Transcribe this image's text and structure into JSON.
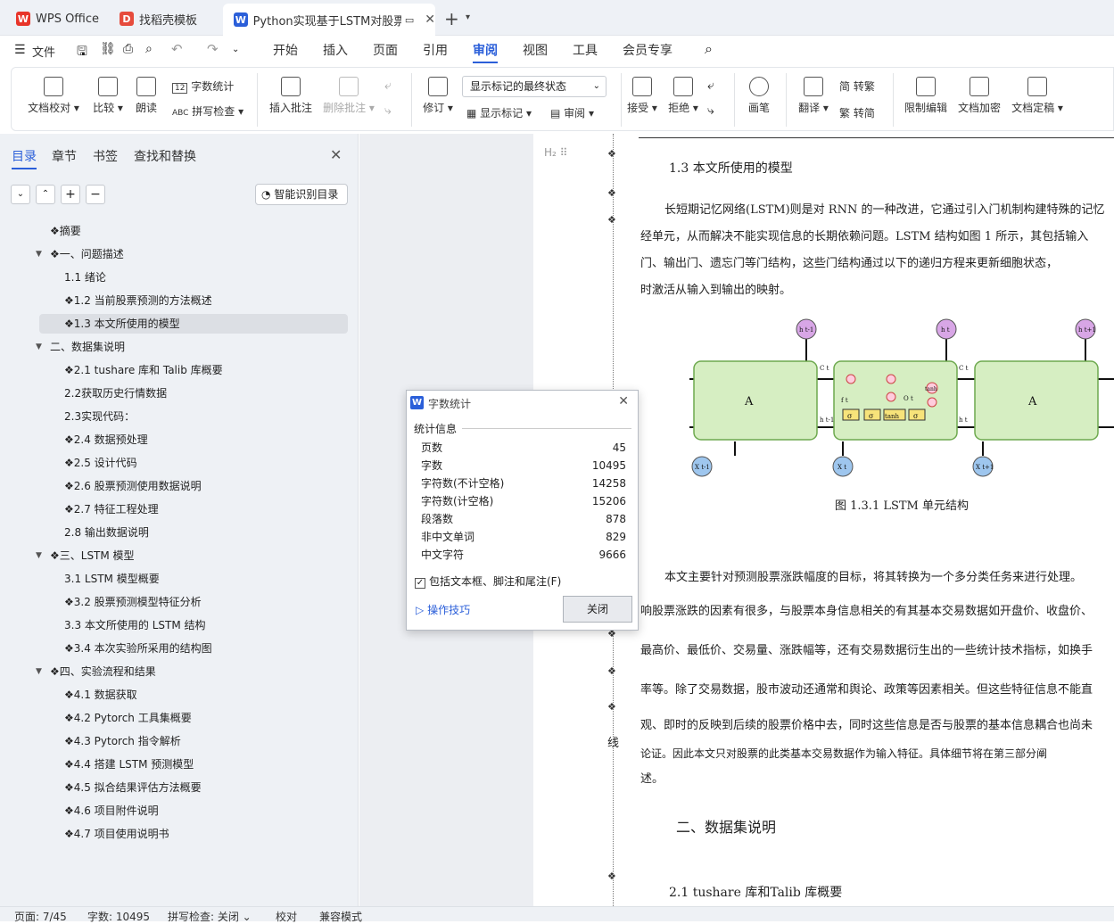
{
  "tabs": [
    {
      "label": "WPS Office"
    },
    {
      "label": "找稻壳模板"
    },
    {
      "label": "Python实现基于LSTM对股票"
    }
  ],
  "menu": {
    "file": "文件",
    "items": [
      "开始",
      "插入",
      "页面",
      "引用",
      "审阅",
      "视图",
      "工具",
      "会员专享"
    ],
    "active": "审阅"
  },
  "ribbon": {
    "doc_check": "文档校对",
    "compare": "比较",
    "read": "朗读",
    "word_count": "字数统计",
    "spell_check": "拼写检查",
    "insert_comment": "插入批注",
    "delete_comment": "删除批注",
    "revise": "修订",
    "markup_state": "显示标记的最终状态",
    "show_markup": "显示标记",
    "review": "审阅",
    "accept": "接受",
    "reject": "拒绝",
    "pen": "画笔",
    "translate": "翻译",
    "to_trad": "简 转繁",
    "to_simp": "繁 转简",
    "restrict": "限制编辑",
    "encrypt": "文档加密",
    "finalize": "文档定稿"
  },
  "sidebar": {
    "tabs": [
      "目录",
      "章节",
      "书签",
      "查找和替换"
    ],
    "smart_toc": "智能识别目录",
    "toc": [
      "❖摘要",
      "❖一、问题描述",
      "1.1 绪论",
      "❖1.2 当前股票预测的方法概述",
      "❖1.3 本文所使用的模型",
      "二、数据集说明",
      "❖2.1 tushare 库和 Talib 库概要",
      "2.2获取历史行情数据",
      "2.3实现代码：",
      "❖2.4 数据预处理",
      "❖2.5 设计代码",
      "❖2.6 股票预测使用数据说明",
      "❖2.7 特征工程处理",
      "2.8 输出数据说明",
      "❖三、LSTM 模型",
      "3.1 LSTM 模型概要",
      "❖3.2 股票预测模型特征分析",
      "3.3 本文所使用的 LSTM 结构",
      "❖3.4 本次实验所采用的结构图",
      "❖四、实验流程和结果",
      "❖4.1 数据获取",
      "❖4.2 Pytorch 工具集概要",
      "❖4.3 Pytorch 指令解析",
      "❖4.4 搭建 LSTM 预测模型",
      "❖4.5 拟合结果评估方法概要",
      "❖4.6 项目附件说明",
      "❖4.7 项目使用说明书"
    ]
  },
  "doc": {
    "heading": "1.3  本文所使用的模型",
    "p1": [
      "长短期记忆网络(LSTM)则是对 RNN  的一种改进，它通过引入门机制构建特殊的记忆",
      "经单元，从而解决不能实现信息的长期依赖问题。LSTM  结构如图 1  所示，其包括输入",
      "门、输出门、遗忘门等门结构，这些门结构通过以下的递归方程来更新细胞状态，",
      "时激活从输入到输出的映射。"
    ],
    "caption": "图 1.3.1 LSTM 单元结构",
    "p2": [
      "本文主要针对预测股票涨跌幅度的目标，将其转换为一个多分类任务来进行处理。",
      "响股票涨跌的因素有很多，与股票本身信息相关的有其基本交易数据如开盘价、收盘价、",
      "最高价、最低价、交易量、涨跌幅等，还有交易数据衍生出的一些统计技术指标，如换手",
      "率等。除了交易数据，股市波动还通常和舆论、政策等因素相关。但这些特征信息不能直",
      "观、即时的反映到后续的股票价格中去，同时这些信息是否与股票的基本信息耦合也尚未",
      "论证。因此本文只对股票的此类基本交易数据作为输入特征。具体细节将在第三部分阐",
      "述。"
    ],
    "h2": "二、数据集说明",
    "h3": "2.1 tushare 库和Talib 库概要",
    "margin_char": "线",
    "diagram": {
      "a": "A",
      "h_prev": "h t-1",
      "h": "h t",
      "h_next": "h t+1",
      "x_prev": "X t-1",
      "x": "X t",
      "x_next": "X t+1",
      "tanh": "tanh",
      "sigma": "σ",
      "c": "C t",
      "f": "f t",
      "o": "O t",
      "hprev": "h t-1",
      "ht": "h t"
    }
  },
  "dialog": {
    "title": "字数统计",
    "section": "统计信息",
    "rows": [
      {
        "k": "页数",
        "v": "45"
      },
      {
        "k": "字数",
        "v": "10495"
      },
      {
        "k": "字符数(不计空格)",
        "v": "14258"
      },
      {
        "k": "字符数(计空格)",
        "v": "15206"
      },
      {
        "k": "段落数",
        "v": "878"
      },
      {
        "k": "非中文单词",
        "v": "829"
      },
      {
        "k": "中文字符",
        "v": "9666"
      }
    ],
    "checkbox": "包括文本框、脚注和尾注(F)",
    "tips": "操作技巧",
    "close": "关闭"
  },
  "status": {
    "page": "页面: 7/45",
    "words": "字数: 10495",
    "spell": "拼写检查: 关闭",
    "proof": "校对",
    "compat": "兼容模式"
  },
  "colors": {
    "accent": "#2b5fd9",
    "cell": "#d6eec2",
    "cell_border": "#6da94e"
  }
}
